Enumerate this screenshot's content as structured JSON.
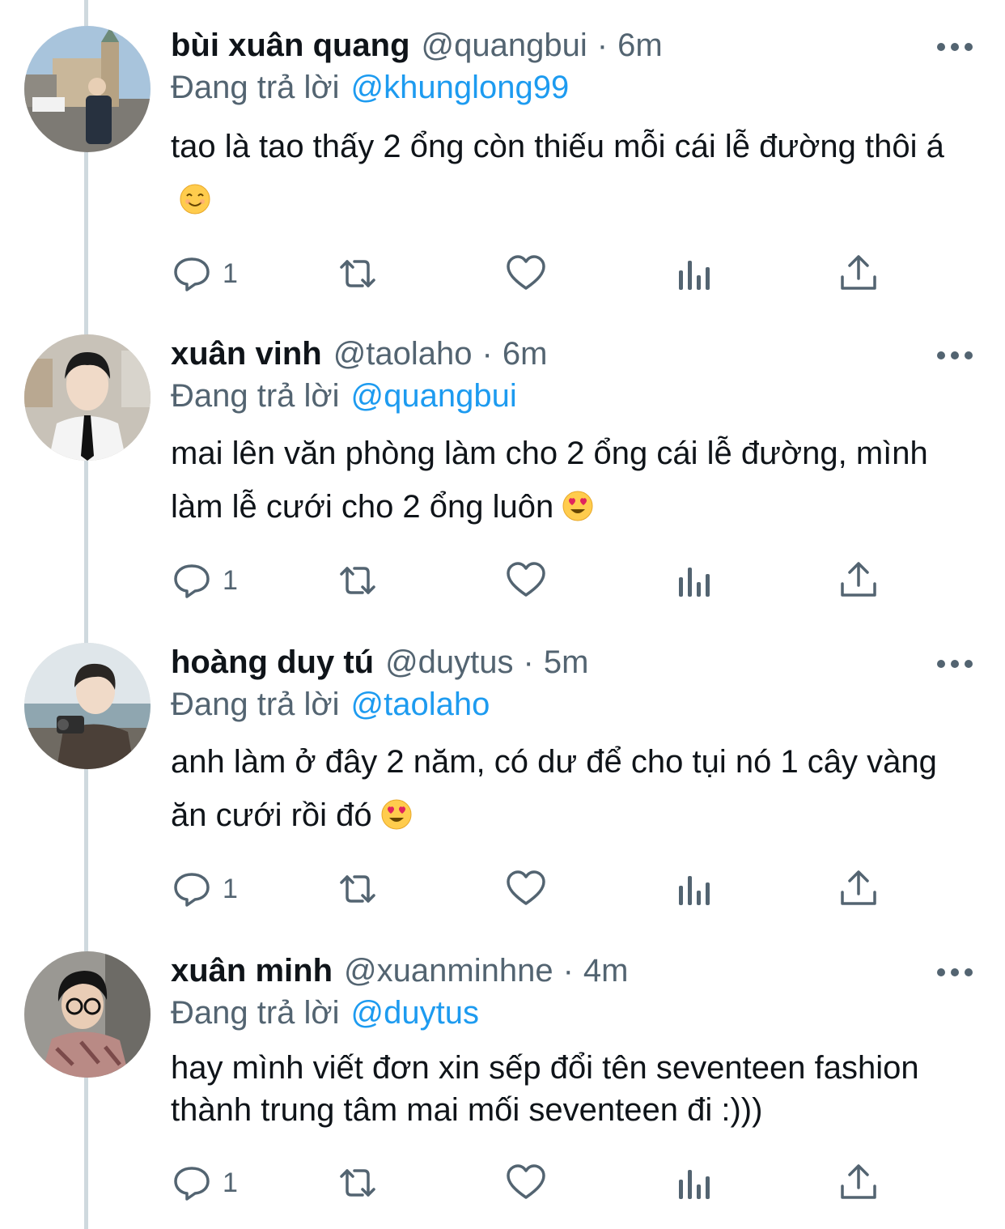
{
  "tweets": [
    {
      "name": "bùi xuân quang",
      "handle": "@quangbui",
      "dot": "·",
      "time": "6m",
      "reply_prefix": "Đang trả lời",
      "reply_to": "@khunglong99",
      "text": "tao là tao thấy 2 ổng còn thiếu mỗi cái lễ đường thôi á",
      "emoji": "smiling-face-icon",
      "reply_count": "1"
    },
    {
      "name": "xuân vinh",
      "handle": "@taolaho",
      "dot": "·",
      "time": "6m",
      "reply_prefix": "Đang trả lời",
      "reply_to": "@quangbui",
      "text": "mai lên văn phòng làm cho 2 ổng cái lễ đường, mình làm lễ cưới cho 2 ổng luôn",
      "emoji": "heart-eyes-icon",
      "reply_count": "1"
    },
    {
      "name": "hoàng duy tú",
      "handle": "@duytus",
      "dot": "·",
      "time": "5m",
      "reply_prefix": "Đang trả lời",
      "reply_to": "@taolaho",
      "text": "anh làm ở đây 2 năm, có dư để cho tụi nó 1 cây vàng ăn cưới rồi đó",
      "emoji": "heart-eyes-icon",
      "reply_count": "1"
    },
    {
      "name": "xuân minh",
      "handle": "@xuanminhne",
      "dot": "·",
      "time": "4m",
      "reply_prefix": "Đang trả lời",
      "reply_to": "@duytus",
      "text": "hay mình viết đơn xin sếp đổi tên seventeen fashion thành trung tâm mai mối seventeen đi :)))",
      "emoji": "",
      "reply_count": "1"
    }
  ],
  "colors": {
    "text": "#0f1419",
    "secondary": "#536471",
    "accent": "#1d9bf0",
    "thread_line": "#cfd9de",
    "emoji": "#ffcc4d"
  }
}
